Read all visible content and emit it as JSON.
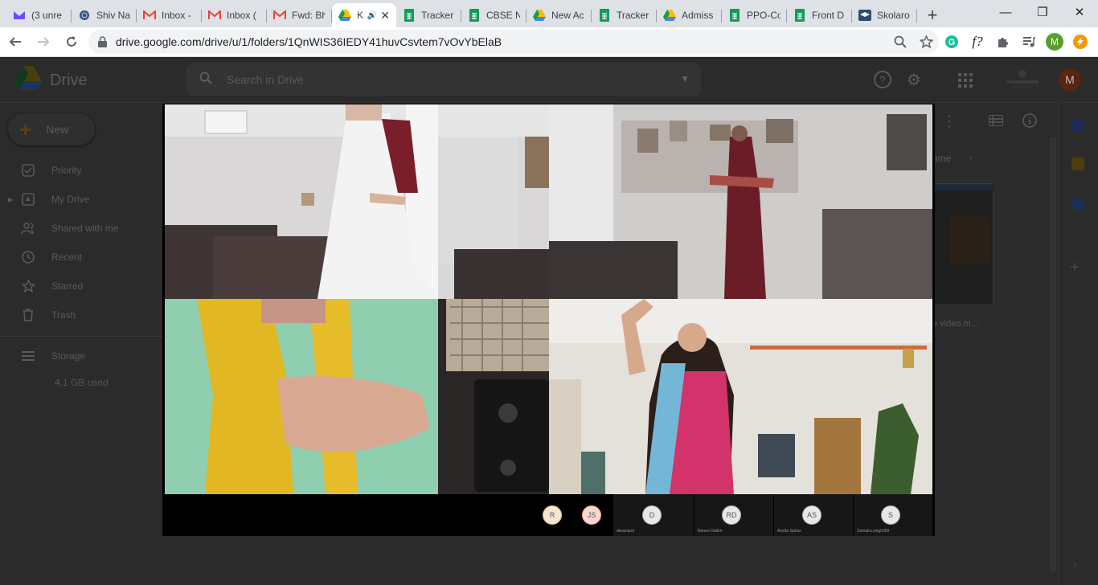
{
  "browser": {
    "tabs": [
      {
        "title": "(3 unre",
        "icon": "proton-mail-icon"
      },
      {
        "title": "Shiv Na",
        "icon": "globe-icon"
      },
      {
        "title": "Inbox -",
        "icon": "gmail-icon"
      },
      {
        "title": "Inbox (",
        "icon": "gmail-icon"
      },
      {
        "title": "Fwd: Bh",
        "icon": "gmail-icon"
      },
      {
        "title": "K",
        "icon": "drive-icon",
        "active": true
      },
      {
        "title": "Tracker",
        "icon": "sheets-icon"
      },
      {
        "title": "CBSE N",
        "icon": "sheets-icon"
      },
      {
        "title": "New Ac",
        "icon": "drive-icon"
      },
      {
        "title": "Tracker",
        "icon": "sheets-icon"
      },
      {
        "title": "Admiss",
        "icon": "drive-icon"
      },
      {
        "title": "PPO-Co",
        "icon": "sheets-icon"
      },
      {
        "title": "Front D",
        "icon": "sheets-icon"
      },
      {
        "title": "Skolaro",
        "icon": "grad-cap-icon"
      }
    ],
    "new_tab": "+",
    "window_controls": {
      "minimize": "—",
      "restore": "❐",
      "close": "✕"
    },
    "url": "drive.google.com/drive/u/1/folders/1QnWIS36IEDY41huvCsvtem7vOvYbElaB",
    "profile_initial": "M",
    "colors": {
      "tabstrip": "#dee1e6",
      "sheets": "#0f9d58",
      "gmail": "#ea4335",
      "profile": "#5a9f2e",
      "ext_orange": "#f29900"
    }
  },
  "drive": {
    "app_name": "Drive",
    "search_placeholder": "Search in Drive",
    "new_button": "New",
    "avatar_initial": "M",
    "nav": [
      {
        "label": "Priority",
        "icon": "check-square-icon"
      },
      {
        "label": "My Drive",
        "icon": "my-drive-icon"
      },
      {
        "label": "Shared with me",
        "icon": "people-icon"
      },
      {
        "label": "Recent",
        "icon": "clock-icon"
      },
      {
        "label": "Starred",
        "icon": "star-icon"
      },
      {
        "label": "Trash",
        "icon": "trash-icon"
      }
    ],
    "storage": {
      "label": "Storage",
      "used": "4.1 GB used"
    },
    "sort_header": "ame",
    "file_caption": "e video.m..."
  },
  "meeting": {
    "participants": [
      {
        "initials": "R",
        "name": ""
      },
      {
        "initials": "JS",
        "name": ""
      },
      {
        "initials": "D",
        "name": "devanand"
      },
      {
        "initials": "RD",
        "name": "Renee Dalton"
      },
      {
        "initials": "AS",
        "name": "Aneita Sahas"
      },
      {
        "initials": "S",
        "name": "Samaira.singh009"
      }
    ]
  }
}
